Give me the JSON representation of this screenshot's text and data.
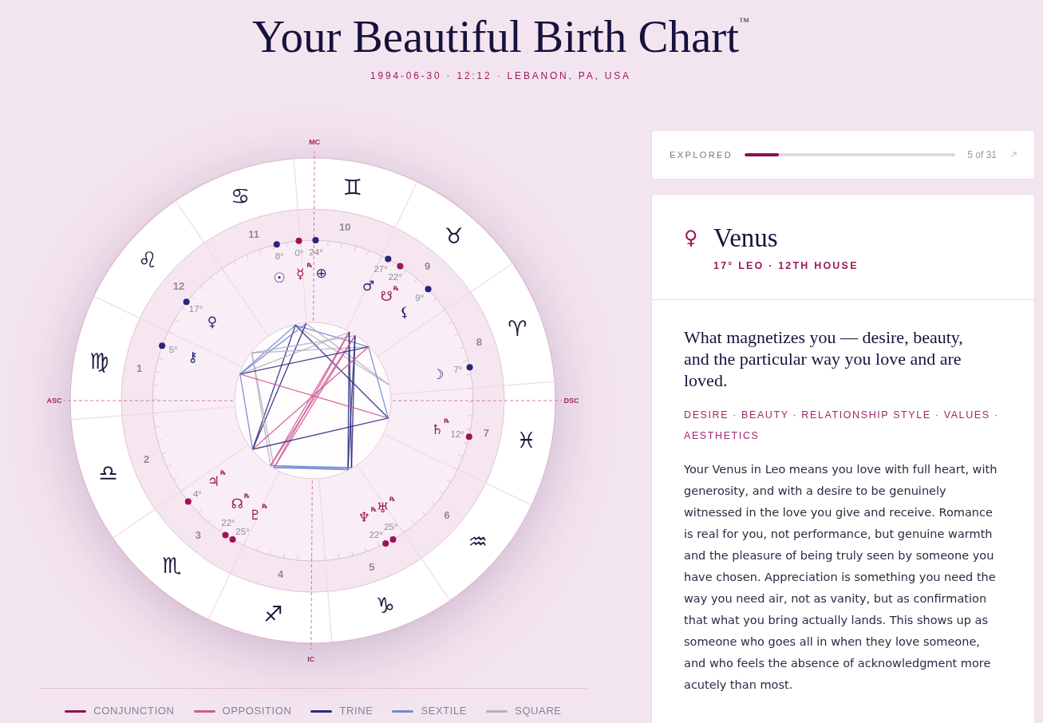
{
  "header": {
    "title": "Your Beautiful Birth Chart$^{™}$",
    "subtitle": "1994-06-30 · 12:12 · LEBANON, PA, USA"
  },
  "wheel": {
    "axes": [
      {
        "kind": "mc",
        "label": "MC"
      },
      {
        "kind": "asc",
        "label": "ASC"
      },
      {
        "kind": "dsc",
        "label": "DSC"
      },
      {
        "kind": "ic",
        "label": "IC"
      }
    ],
    "segments": [
      {
        "house": "11",
        "sign": "♋︎",
        "planets": [
          {
            "glyph": "☉",
            "degree": "8°",
            "retrograde": false
          },
          {
            "glyph": "☿",
            "retrograde_mark": "℞",
            "degree": "0°",
            "retrograde": true
          }
        ]
      },
      {
        "house": "10",
        "sign": "♊︎",
        "planets": [
          {
            "glyph": "⊕",
            "degree": "24°",
            "retrograde": false
          }
        ]
      },
      {
        "house": "12",
        "sign": "♌︎",
        "planets": [
          {
            "glyph": "♀",
            "degree": "17°",
            "retrograde": false
          }
        ]
      },
      {
        "house": "9",
        "sign": "♉︎",
        "planets": [
          {
            "glyph": "♂",
            "degree": "27°",
            "retrograde": false
          },
          {
            "glyph": "☋",
            "retrograde_mark": "℞",
            "degree": "22°",
            "retrograde": true
          },
          {
            "glyph": "⚸",
            "degree": "9°",
            "retrograde": false
          }
        ]
      },
      {
        "house": "1",
        "sign": "♍︎",
        "planets": [
          {
            "glyph": "⚷",
            "degree": "5°",
            "retrograde": false
          }
        ]
      },
      {
        "house": "8",
        "sign": "♈︎",
        "planets": [
          {
            "glyph": "☽",
            "degree": "7°",
            "retrograde": false
          }
        ]
      },
      {
        "house": "7",
        "sign": "♓︎",
        "planets": [
          {
            "glyph": "♄",
            "retrograde_mark": "℞",
            "degree": "12°",
            "retrograde": true
          }
        ]
      },
      {
        "house": "2",
        "sign": "♎︎"
      },
      {
        "house": "3",
        "sign": "♏︎",
        "planets": [
          {
            "glyph": "♃",
            "retrograde_mark": "℞",
            "degree": "4°",
            "retrograde": true
          },
          {
            "glyph": "☊",
            "retrograde_mark": "℞",
            "degree": "22°",
            "retrograde": true
          },
          {
            "glyph": "♇",
            "retrograde_mark": "℞",
            "degree": "25°",
            "retrograde": true
          }
        ]
      },
      {
        "house": "4",
        "sign": "♐︎"
      },
      {
        "house": "5",
        "sign": "♑︎",
        "planets": [
          {
            "glyph": "♆",
            "retrograde_mark": "℞",
            "degree": "22°",
            "retrograde": true
          },
          {
            "glyph": "♅",
            "retrograde_mark": "℞",
            "degree": "25°",
            "retrograde": true
          }
        ]
      },
      {
        "house": "6",
        "sign": "♒︎"
      }
    ]
  },
  "legend": [
    {
      "kind": "conjunction",
      "label": "CONJUNCTION",
      "color": "#8e1150"
    },
    {
      "kind": "opposition",
      "label": "OPPOSITION",
      "color": "#cf5b93"
    },
    {
      "kind": "trine",
      "label": "TRINE",
      "color": "#2a2a80"
    },
    {
      "kind": "sextile",
      "label": "SEXTILE",
      "color": "#7189d0"
    },
    {
      "kind": "square",
      "label": "SQUARE",
      "color": "#b9aebf"
    }
  ],
  "progress": {
    "label": "EXPLORED",
    "level": 0.161,
    "count": "5 of 31"
  },
  "detail": {
    "glyph": "♀",
    "name": "Venus",
    "position": "17° LEO · 12TH HOUSE",
    "question": "What magnetizes you — desire, beauty, and the particular way you love and are loved.",
    "tags": "DESIRE · BEAUTY · RELATIONSHIP STYLE · VALUES · AESTHETICS",
    "body": "Your Venus in Leo means you love with full heart, with generosity, and with a desire to be genuinely witnessed in the love you give and receive. Romance is real for you, not performance, but genuine warmth and the pleasure of being truly seen by someone you have chosen. Appreciation is something you need the way you need air, not as vanity, but as confirmation that what you bring actually lands. This shows up as someone who goes all in when they love someone, and who feels the absence of acknowledgment more acutely than most."
  }
}
